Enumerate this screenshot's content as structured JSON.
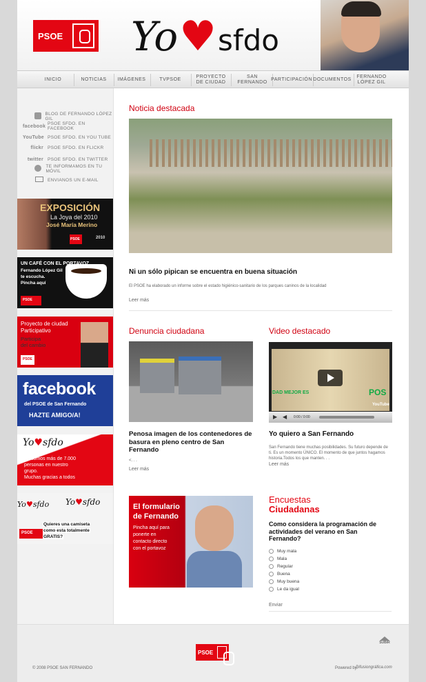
{
  "brand": {
    "psoe": "PSOE",
    "yo": "Yo",
    "sfdo": "sfdo"
  },
  "nav": [
    {
      "label": "INICIO"
    },
    {
      "label": "NOTICIAS"
    },
    {
      "label": "IMÁGENES"
    },
    {
      "label": "TVPSOE"
    },
    {
      "label": "PROYECTO DE CIUDAD"
    },
    {
      "label": "SAN FERNANDO"
    },
    {
      "label": "PARTICIPACIÓN"
    },
    {
      "label": "DOCUMENTOS"
    },
    {
      "label": "FERNANDO LÓPEZ GIL"
    }
  ],
  "social": [
    {
      "icon": "blog-icon",
      "brand": "",
      "label": "BLOG DE FERNANDO LÓPEZ GIL"
    },
    {
      "icon": "facebook-icon",
      "brand": "facebook",
      "label": "PSOE SFDO. EN FACEBOOK"
    },
    {
      "icon": "youtube-icon",
      "brand": "YouTube",
      "label": "PSOE SFDO. EN YOU TUBE"
    },
    {
      "icon": "flickr-icon",
      "brand": "flickr",
      "label": "PSOE SFDO. EN FLICKR"
    },
    {
      "icon": "twitter-icon",
      "brand": "twitter",
      "label": "PSOE SFDO. EN TWITTER"
    },
    {
      "icon": "sms-icon",
      "brand": "",
      "label": "TE INFORMAMOS EN TU MÓVIL"
    },
    {
      "icon": "email-icon",
      "brand": "",
      "label": "ENVIANOS UN E-MAIL"
    }
  ],
  "banners": {
    "expo": {
      "title": "EXPOSICIÓN",
      "line1": "La Joya del 2010",
      "line2": "José María Merino",
      "year": "2010"
    },
    "cafe": {
      "title": "UN CAFÉ CON EL PORTAVOZ",
      "line1": "Fernando López Gil",
      "line2": "te escucha.",
      "line3": "Pincha aquí"
    },
    "proyecto": {
      "line1": "Proyecto de ciudad",
      "line2": "Participativo",
      "line3": "Participa",
      "line4": "del cambio"
    },
    "facebook": {
      "title": "facebook",
      "line1": "del PSOE de San Fernando",
      "line2": "HAZTE AMIGO/A!"
    },
    "grupo": {
      "line1": "Ya somos más de 7.000",
      "line2": "personas en nuestro",
      "line3": "grupo.",
      "line4": "Muchas gracias a todos"
    },
    "camiseta": {
      "line1": "Quieres una camiseta",
      "line2": "como esta totalmente",
      "line3": "GRATIS?"
    }
  },
  "noticia": {
    "section": "Noticia destacada",
    "title": "Ni un sólo pipican se encuentra en buena situación",
    "text": "El PSOE ha elaborado un informe sobre el estado higiénico-sanitario de los parques caninos de la localidad",
    "more": "Leer más"
  },
  "denuncia": {
    "section": "Denuncia ciudadana",
    "title": "Penosa imagen de los contenedores de basura en pleno centro de San Fernando",
    "text": "<. . .",
    "more": "Leer más"
  },
  "video": {
    "section": "Video destacado",
    "overlay": "DAD MEJOR ES",
    "overlay2": "POS",
    "time": "0:00 / 0:00",
    "yt": "YouTube",
    "title": "Yo quiero a San Fernando",
    "text": "San Fernando tiene muchas posibilidades. Su futuro depende de ti. Es un momento ÚNICO. El momento de que juntos hagamos historia.Todos los que manten. . .",
    "more": "Leer más"
  },
  "formulario": {
    "title1": "El formulario",
    "title2": "de Fernando",
    "text1": "Pincha aquí para",
    "text2": "ponerte en",
    "text3": "contacto directo",
    "text4": "con el portavoz"
  },
  "encuesta": {
    "title1": "Encuestas",
    "title2": "Ciudadanas",
    "question": "Como considera la programación de actividades del verano en San Fernando?",
    "options": [
      "Muy mala",
      "Mala",
      "Regular",
      "Buena",
      "Muy buena",
      "Le da igual"
    ],
    "submit": "Enviar"
  },
  "footer": {
    "copyright": "© 2008 PSOE SAN FERNANDO",
    "subir": "SUBIR",
    "powered": "Powered by:",
    "powered_brand": "Difusiongráfica.com"
  },
  "colors": {
    "red": "#e30613",
    "dark_red": "#d00010",
    "facebook_blue": "#1f3f98"
  }
}
